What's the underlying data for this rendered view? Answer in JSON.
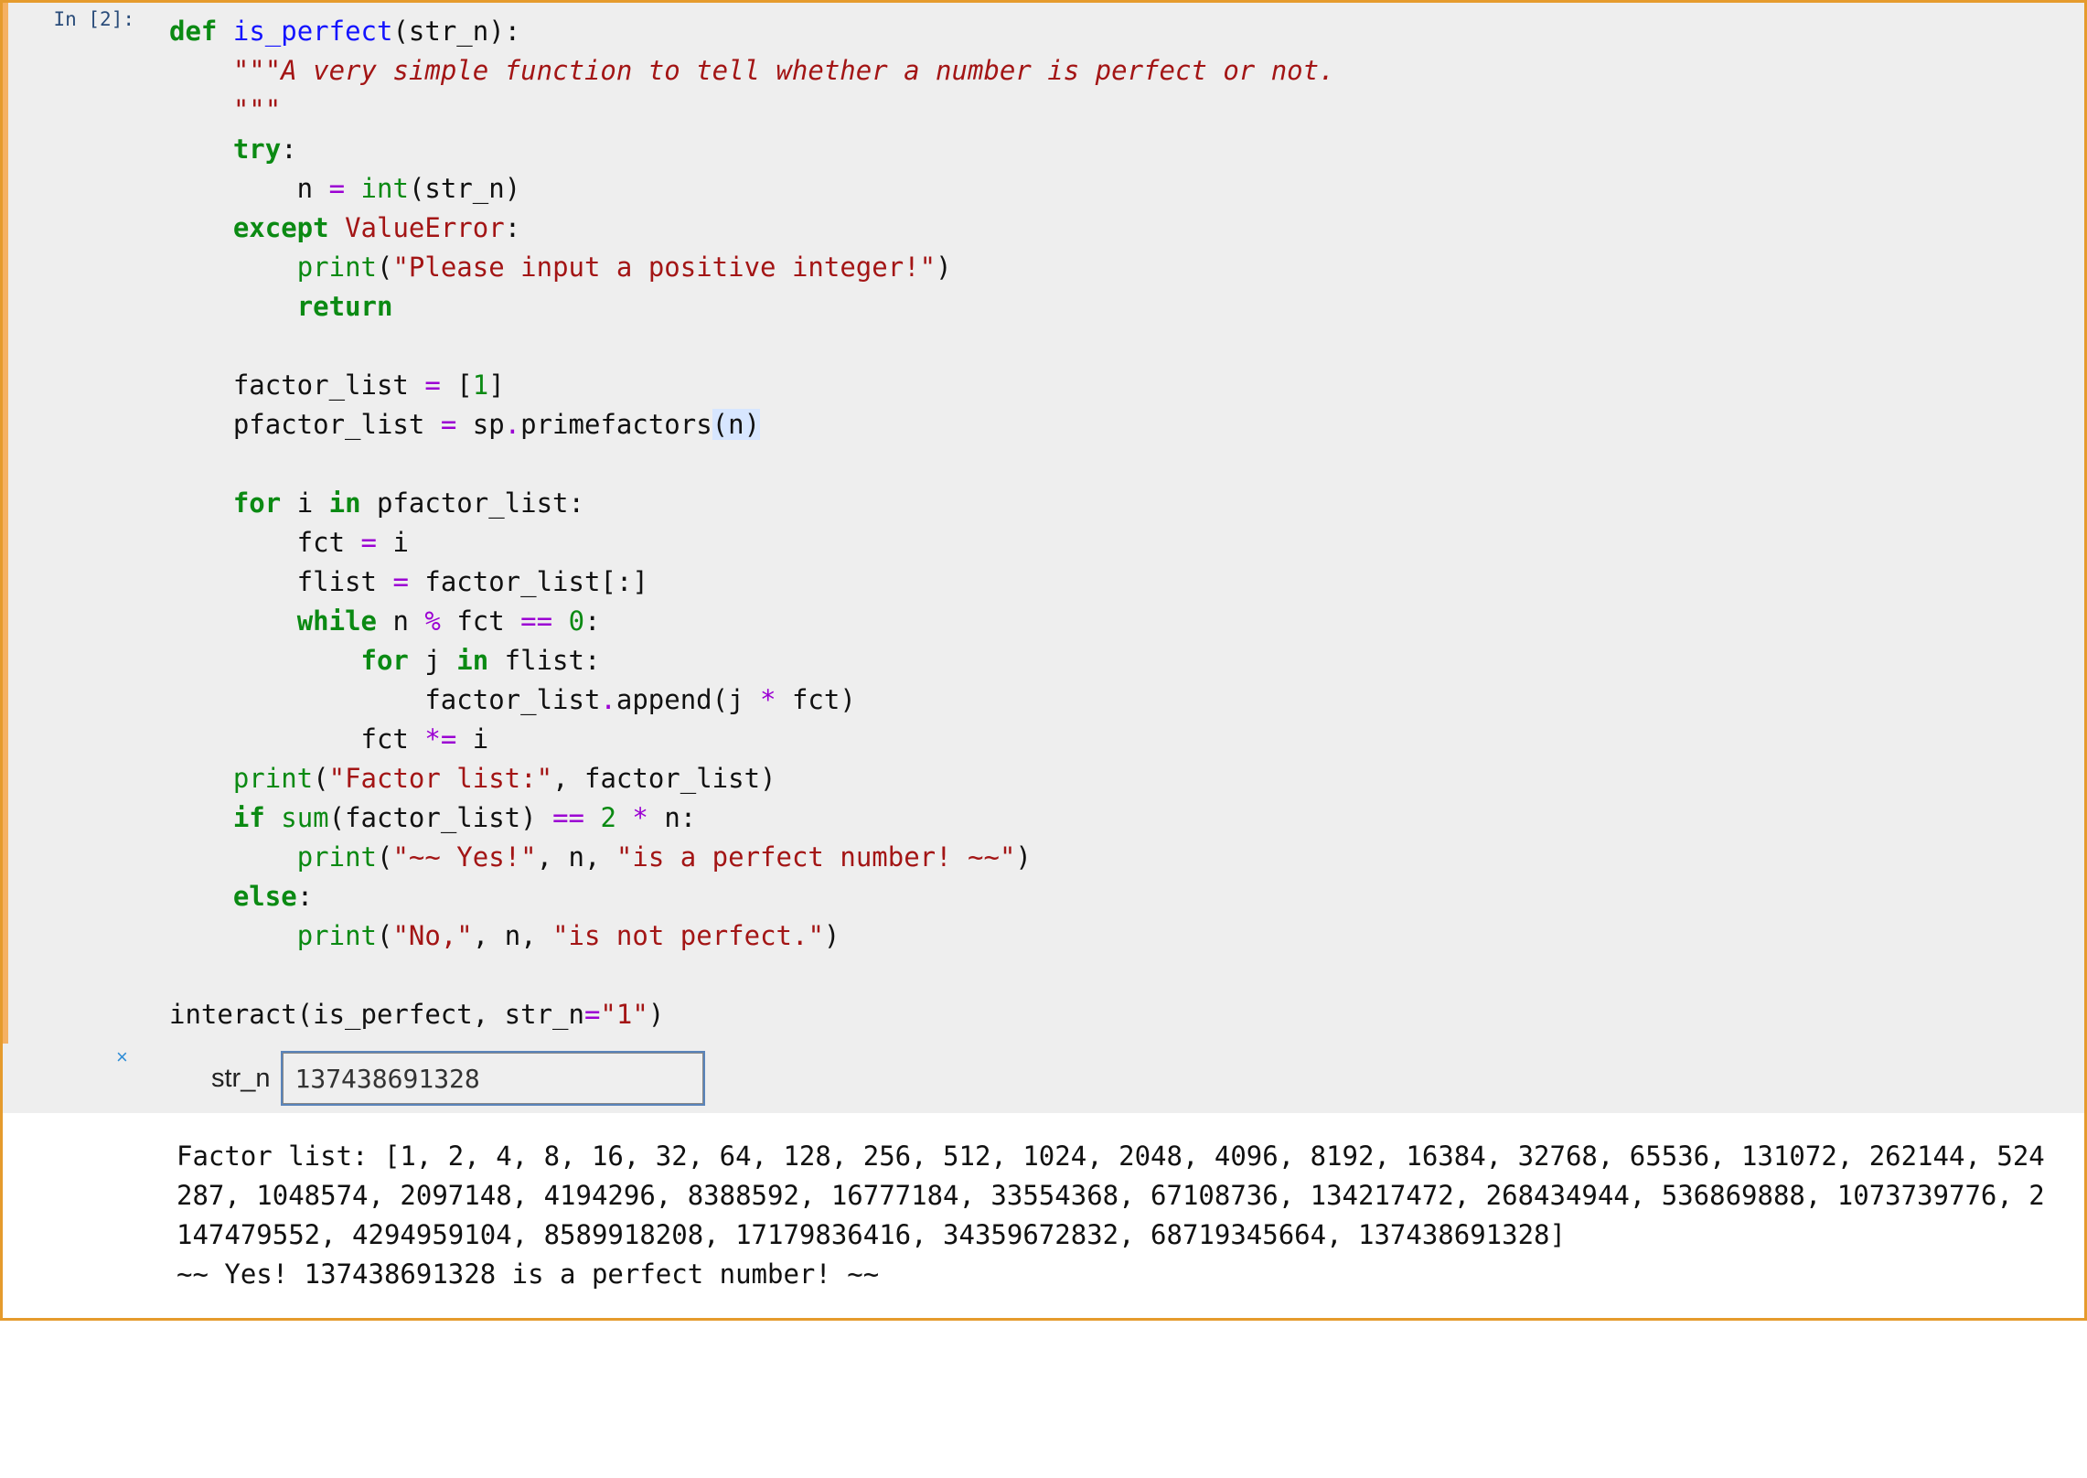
{
  "prompt": "In [2]:",
  "code": {
    "l1a": "def",
    "l1b": "is_perfect",
    "l1c": "(str_n):",
    "l2a": "    ",
    "l2b": "\"\"\"A very simple function to tell whether a number is perfect or not.",
    "l3a": "    ",
    "l3b": "\"\"\"",
    "l4a": "    ",
    "l4b": "try",
    "l4c": ":",
    "l5a": "        n ",
    "l5b": "=",
    "l5c": " ",
    "l5d": "int",
    "l5e": "(str_n)",
    "l6a": "    ",
    "l6b": "except",
    "l6c": " ",
    "l6d": "ValueError",
    "l6e": ":",
    "l7a": "        ",
    "l7b": "print",
    "l7c": "(",
    "l7d": "\"Please input a positive integer!\"",
    "l7e": ")",
    "l8a": "        ",
    "l8b": "return",
    "l9": "",
    "l10a": "    factor_list ",
    "l10b": "=",
    "l10c": " [",
    "l10d": "1",
    "l10e": "]",
    "l11a": "    pfactor_list ",
    "l11b": "=",
    "l11c": " sp",
    "l11d": ".",
    "l11e": "primefactors",
    "l11f": "(n)",
    "l12": "",
    "l13a": "    ",
    "l13b": "for",
    "l13c": " i ",
    "l13d": "in",
    "l13e": " pfactor_list:",
    "l14a": "        fct ",
    "l14b": "=",
    "l14c": " i",
    "l15a": "        flist ",
    "l15b": "=",
    "l15c": " factor_list[:]",
    "l16a": "        ",
    "l16b": "while",
    "l16c": " n ",
    "l16d": "%",
    "l16e": " fct ",
    "l16f": "==",
    "l16g": " ",
    "l16h": "0",
    "l16i": ":",
    "l17a": "            ",
    "l17b": "for",
    "l17c": " j ",
    "l17d": "in",
    "l17e": " flist:",
    "l18a": "                factor_list",
    "l18b": ".",
    "l18c": "append(j ",
    "l18d": "*",
    "l18e": " fct)",
    "l19a": "            fct ",
    "l19b": "*=",
    "l19c": " i",
    "l20a": "    ",
    "l20b": "print",
    "l20c": "(",
    "l20d": "\"Factor list:\"",
    "l20e": ", factor_list)",
    "l21a": "    ",
    "l21b": "if",
    "l21c": " ",
    "l21d": "sum",
    "l21e": "(factor_list) ",
    "l21f": "==",
    "l21g": " ",
    "l21h": "2",
    "l21i": " ",
    "l21j": "*",
    "l21k": " n:",
    "l22a": "        ",
    "l22b": "print",
    "l22c": "(",
    "l22d": "\"~~ Yes!\"",
    "l22e": ", n, ",
    "l22f": "\"is a perfect number! ~~\"",
    "l22g": ")",
    "l23a": "    ",
    "l23b": "else",
    "l23c": ":",
    "l24a": "        ",
    "l24b": "print",
    "l24c": "(",
    "l24d": "\"No,\"",
    "l24e": ", n, ",
    "l24f": "\"is not perfect.\"",
    "l24g": ")",
    "l25": "",
    "l26a": "interact(is_perfect, str_n",
    "l26b": "=",
    "l26c": "\"1\"",
    "l26d": ")"
  },
  "widget": {
    "close": "×",
    "label": "str_n",
    "value": "137438691328"
  },
  "output": "Factor list: [1, 2, 4, 8, 16, 32, 64, 128, 256, 512, 1024, 2048, 4096, 8192, 16384, 32768, 65536, 131072, 262144, 524287, 1048574, 2097148, 4194296, 8388592, 16777184, 33554368, 67108736, 134217472, 268434944, 536869888, 1073739776, 2147479552, 4294959104, 8589918208, 17179836416, 34359672832, 68719345664, 137438691328]\n~~ Yes! 137438691328 is a perfect number! ~~"
}
